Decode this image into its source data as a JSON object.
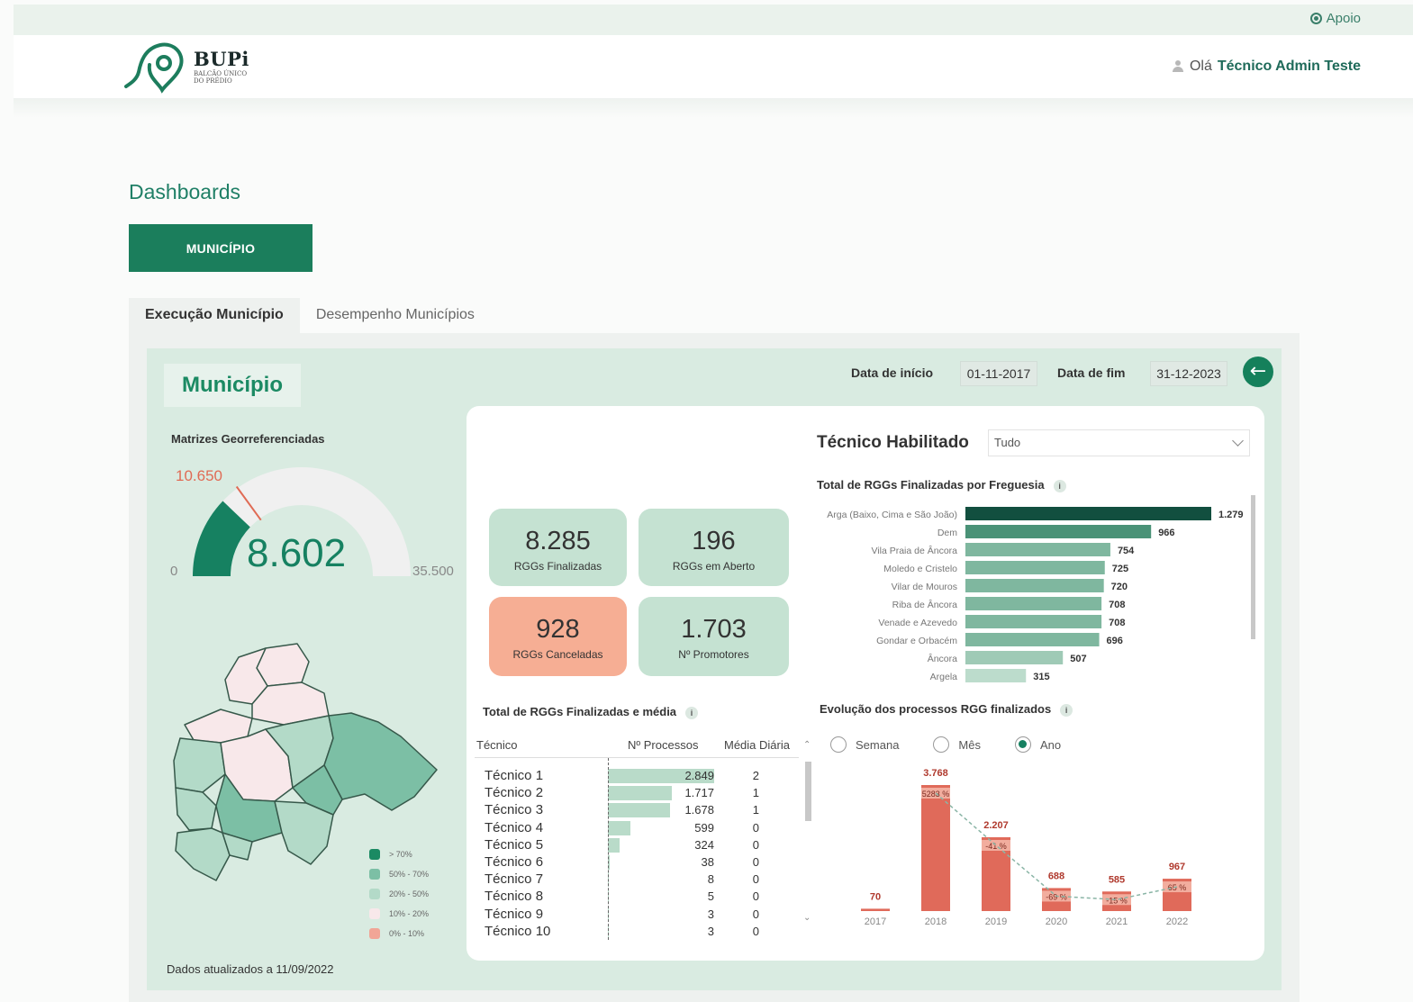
{
  "topbar": {
    "support": "Apoio",
    "greeting": "Olá",
    "user_name": "Técnico Admin Teste"
  },
  "logo": {
    "title": "BUPi",
    "subtitle": "BALCÃO ÚNICO DO PRÉDIO"
  },
  "page": {
    "title": "Dashboards",
    "section_button": "MUNICÍPIO"
  },
  "tabs": [
    {
      "label": "Execução Município",
      "active": true
    },
    {
      "label": "Desempenho Municípios",
      "active": false
    }
  ],
  "board": {
    "title": "Município",
    "start_label": "Data de início",
    "start_value": "01-11-2017",
    "end_label": "Data de fim",
    "end_value": "31-12-2023",
    "back_icon": "arrow-left-icon",
    "updated": "Dados atualizados a 11/09/2022"
  },
  "gauge": {
    "title": "Matrizes Georreferenciadas",
    "value": 8602,
    "value_label": "8.602",
    "target": 10650,
    "target_label": "10.650",
    "min": 0,
    "min_label": "0",
    "max": 35500,
    "max_label": "35.500",
    "fill_color": "#168161",
    "track_color": "#f0f0f0",
    "target_color": "#e06b55"
  },
  "map_legend": [
    {
      "label": "> 70%",
      "color": "#1b8a63"
    },
    {
      "label": "50% - 70%",
      "color": "#7cbfa5"
    },
    {
      "label": "20% - 50%",
      "color": "#b3dac8"
    },
    {
      "label": "10% - 20%",
      "color": "#f8e8ea"
    },
    {
      "label": "0% - 10%",
      "color": "#f1a596"
    }
  ],
  "kpis": [
    {
      "value": "8.285",
      "label": "RGGs Finalizadas"
    },
    {
      "value": "196",
      "label": "RGGs em Aberto"
    },
    {
      "value": "928",
      "label": "RGGs Canceladas"
    },
    {
      "value": "1.703",
      "label": "Nº Promotores"
    }
  ],
  "tech_table": {
    "title": "Total de RGGs Finalizadas e média",
    "columns": [
      "Técnico",
      "Nº Processos",
      "Média Diária"
    ],
    "max": 2849,
    "rows": [
      {
        "name": "Técnico 1",
        "processes": 2849,
        "processes_label": "2.849",
        "daily": "2"
      },
      {
        "name": "Técnico 2",
        "processes": 1717,
        "processes_label": "1.717",
        "daily": "1"
      },
      {
        "name": "Técnico 3",
        "processes": 1678,
        "processes_label": "1.678",
        "daily": "1"
      },
      {
        "name": "Técnico 4",
        "processes": 599,
        "processes_label": "599",
        "daily": "0"
      },
      {
        "name": "Técnico 5",
        "processes": 324,
        "processes_label": "324",
        "daily": "0"
      },
      {
        "name": "Técnico 6",
        "processes": 38,
        "processes_label": "38",
        "daily": "0"
      },
      {
        "name": "Técnico 7",
        "processes": 8,
        "processes_label": "8",
        "daily": "0"
      },
      {
        "name": "Técnico 8",
        "processes": 5,
        "processes_label": "5",
        "daily": "0"
      },
      {
        "name": "Técnico 9",
        "processes": 3,
        "processes_label": "3",
        "daily": "0"
      },
      {
        "name": "Técnico 10",
        "processes": 3,
        "processes_label": "3",
        "daily": "0"
      }
    ]
  },
  "filter": {
    "title": "Técnico Habilitado",
    "value": "Tudo"
  },
  "chart_data": [
    {
      "type": "bar",
      "orientation": "horizontal",
      "title": "Total de RGGs Finalizadas por Freguesia",
      "categories": [
        "Arga (Baixo, Cima e São João)",
        "Dem",
        "Vila Praia de Âncora",
        "Moledo e Cristelo",
        "Vilar de Mouros",
        "Riba de Âncora",
        "Venade e Azevedo",
        "Gondar e Orbacém",
        "Âncora",
        "Argela"
      ],
      "values": [
        1279,
        966,
        754,
        725,
        720,
        708,
        708,
        696,
        507,
        315
      ],
      "value_labels": [
        "1.279",
        "966",
        "754",
        "725",
        "720",
        "708",
        "708",
        "696",
        "507",
        "315"
      ],
      "colors": [
        "#124f3f",
        "#4a9277",
        "#7fb79f",
        "#7fb79f",
        "#7fb79f",
        "#7fb79f",
        "#7fb79f",
        "#7fb79f",
        "#9fcab6",
        "#bcdccc"
      ],
      "xlim": [
        0,
        1279
      ]
    },
    {
      "type": "bar",
      "title": "Evolução dos processos RGG finalizados",
      "categories": [
        "2017",
        "2018",
        "2019",
        "2020",
        "2021",
        "2022"
      ],
      "values": [
        70,
        3768,
        2207,
        688,
        585,
        967
      ],
      "value_labels": [
        "70",
        "3.768",
        "2.207",
        "688",
        "585",
        "967"
      ],
      "change_labels": [
        "",
        "5283 %",
        "-41 %",
        "-69 %",
        "-15 %",
        "65 %"
      ],
      "ylim": [
        0,
        3768
      ],
      "bar_color": "#e06a5a",
      "change_color": "#f4b8aa",
      "periods": [
        {
          "label": "Semana",
          "selected": false
        },
        {
          "label": "Mês",
          "selected": false
        },
        {
          "label": "Ano",
          "selected": true
        }
      ]
    }
  ]
}
